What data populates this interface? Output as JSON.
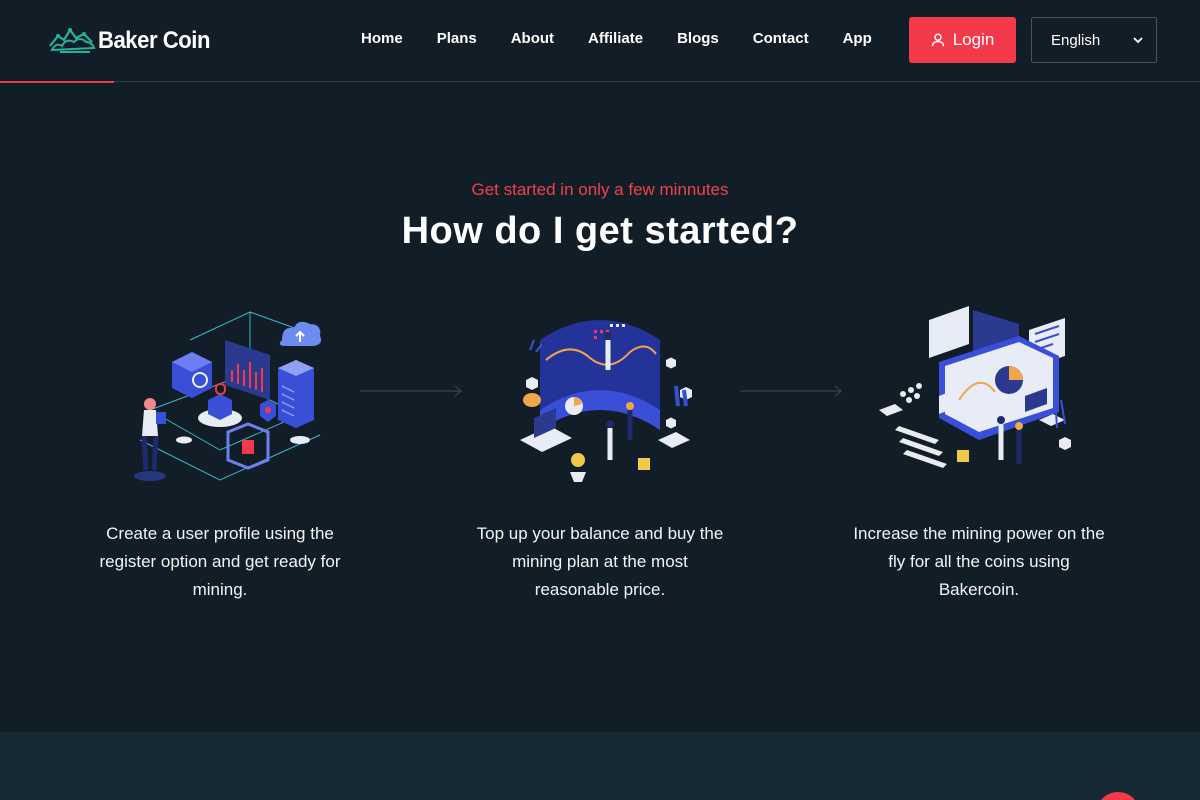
{
  "brand": {
    "name": "Baker Coin",
    "accent": "#f3394a",
    "logo_color": "#27b19a"
  },
  "nav": {
    "items": [
      {
        "label": "Home"
      },
      {
        "label": "Plans"
      },
      {
        "label": "About"
      },
      {
        "label": "Affiliate"
      },
      {
        "label": "Blogs"
      },
      {
        "label": "Contact"
      },
      {
        "label": "App"
      }
    ]
  },
  "header": {
    "login_label": "Login",
    "login_icon": "user-icon",
    "language": {
      "selected": "English",
      "icon": "chevron-down-icon"
    }
  },
  "hero": {
    "kicker": "Get started in only a few minnutes",
    "title": "How do I get started?"
  },
  "steps": [
    {
      "text": "Create a user profile using the register option and get ready for mining.",
      "illustration": "server-setup-illustration"
    },
    {
      "text": "Top up your balance and buy the mining plan at the most reasonable price.",
      "illustration": "data-dashboard-illustration"
    },
    {
      "text": "Increase the mining power on the fly for all the coins using Bakercoin.",
      "illustration": "analytics-monitor-illustration"
    }
  ],
  "colors": {
    "background": "#121e27",
    "band": "#172a33",
    "kicker": "#f0404c",
    "illustration_blue": "#3a4fd8",
    "illustration_light": "#e8ecf7"
  }
}
